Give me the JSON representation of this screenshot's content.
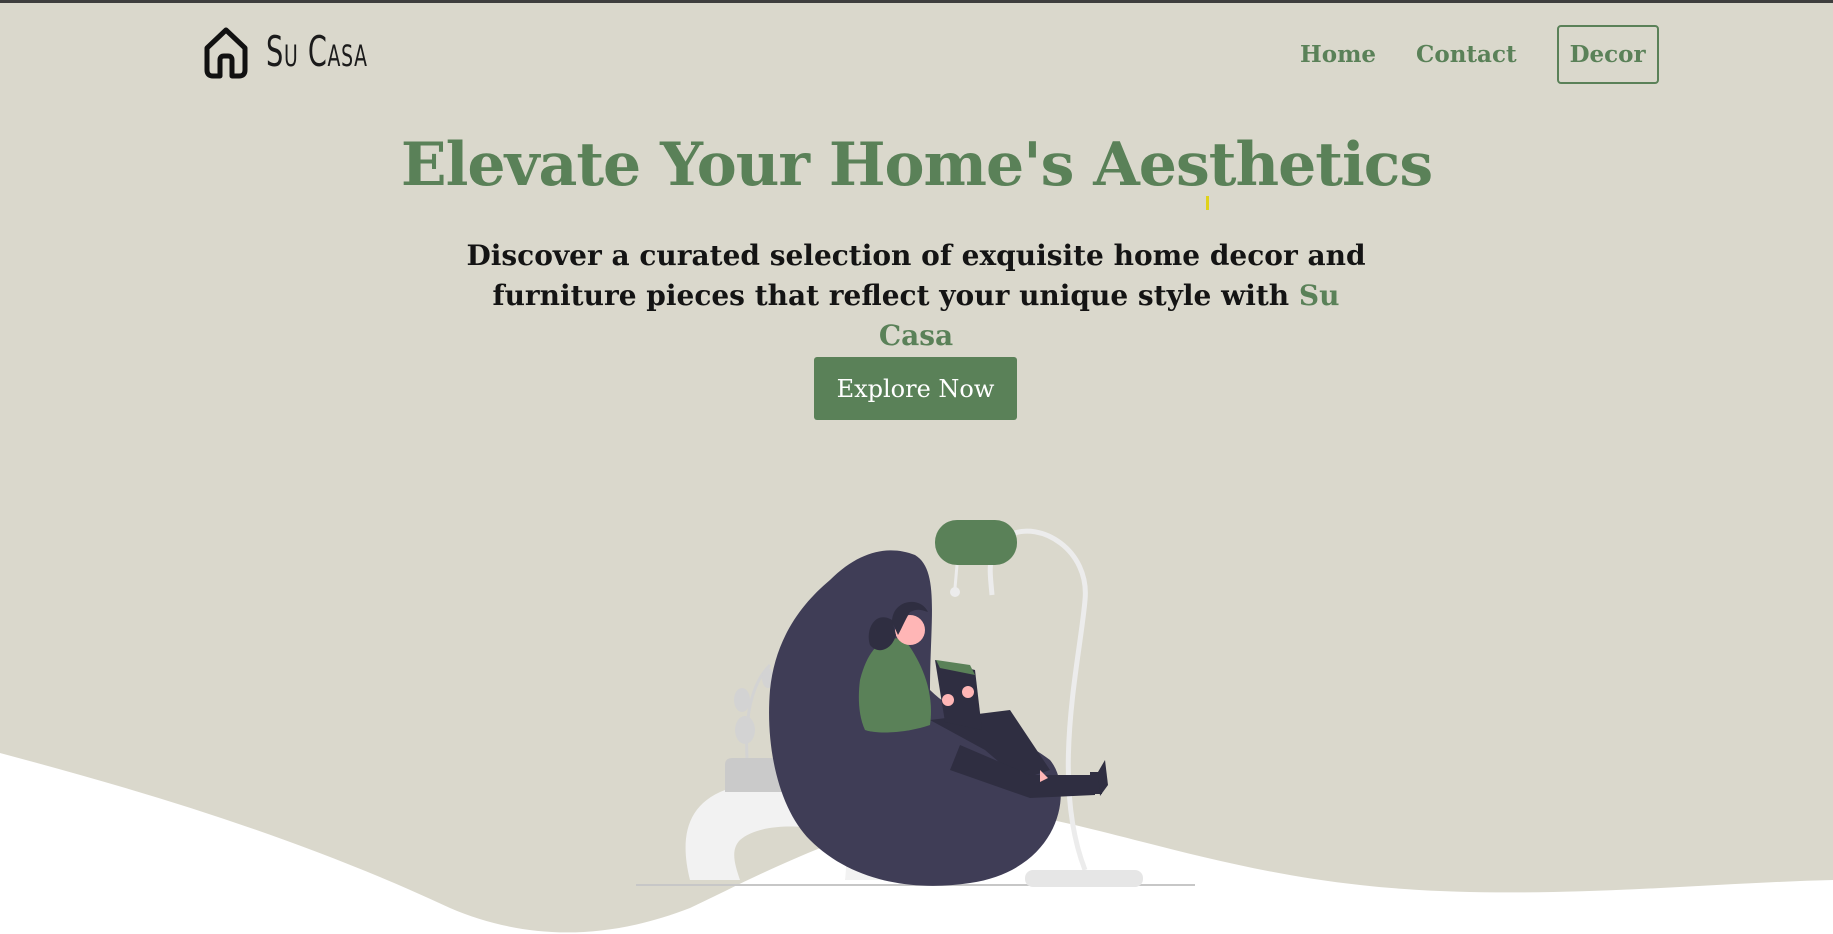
{
  "brand": {
    "name": "Su Casa",
    "logo_icon": "house-icon"
  },
  "nav": {
    "items": [
      "Home",
      "Contact",
      "Decor"
    ]
  },
  "hero": {
    "title": "Elevate Your Home's Aesthetics",
    "subtitle_line1": "Discover a curated selection of exquisite home decor and",
    "subtitle_line2": "furniture pieces that reflect your unique style with",
    "subtitle_brand": "Su Casa",
    "cta_label": "Explore Now"
  },
  "colors": {
    "accent": "#5a8158",
    "background": "#dad8cc",
    "chair": "#3f3d56",
    "text": "#141414"
  }
}
